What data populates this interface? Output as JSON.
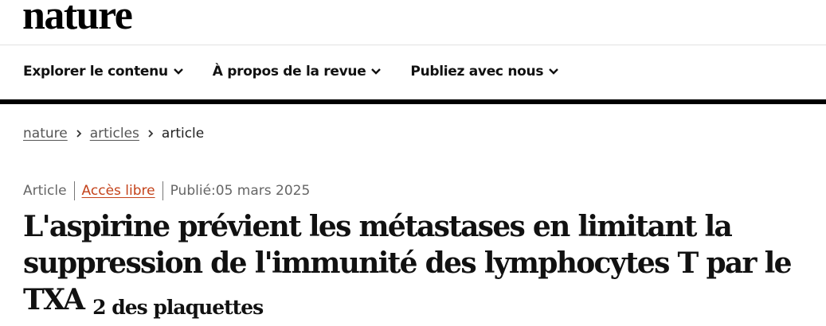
{
  "site": {
    "logo": "nature"
  },
  "nav": {
    "items": [
      {
        "label": "Explorer le contenu"
      },
      {
        "label": "À propos de la revue"
      },
      {
        "label": "Publiez avec nous"
      }
    ]
  },
  "breadcrumb": {
    "items": [
      {
        "label": "nature"
      },
      {
        "label": "articles"
      },
      {
        "label": "article"
      }
    ]
  },
  "article": {
    "type": "Article",
    "access": "Accès libre",
    "published": "Publié:05 mars 2025",
    "title_main": "L'aspirine prévient les métastases en limitant la suppression de l'immunité des lymphocytes T par le TXA",
    "title_sub": "2 des plaquettes"
  },
  "colors": {
    "accent": "#c4431b",
    "text": "#111111"
  }
}
